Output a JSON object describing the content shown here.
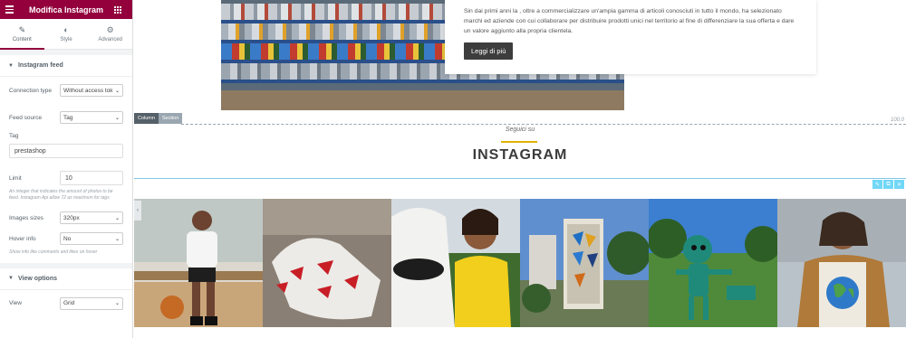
{
  "panel": {
    "title": "Modifica Instagram",
    "tabs": [
      {
        "label": "Content",
        "icon": "pencil-icon"
      },
      {
        "label": "Style",
        "icon": "half-circle-icon"
      },
      {
        "label": "Advanced",
        "icon": "gear-icon"
      }
    ],
    "section_feed": "Instagram feed",
    "connection_type": {
      "label": "Connection type",
      "value": "Without access tok"
    },
    "feed_source": {
      "label": "Feed source",
      "value": "Tag"
    },
    "tag": {
      "label": "Tag",
      "value": "prestashop"
    },
    "limit": {
      "label": "Limit",
      "value": "10",
      "help": "An integer that indicates the amount of photos to be feed. Instagram Api allow 72 as maximum for tags"
    },
    "images_sizes": {
      "label": "Images sizes",
      "value": "320px"
    },
    "hover_info": {
      "label": "Hover info",
      "value": "No",
      "help": "Show info like comments and likes on hover"
    },
    "section_view": "View options",
    "view": {
      "label": "View",
      "value": "Grid"
    }
  },
  "about": {
    "text": "Sin dai primi anni la                   , oltre a commercializzare un'ampia gamma di articoli conosciuti in tutto il mondo, ha selezionato marchi ed aziende con cui collaborare per distribuire prodotti unici nel territorio al fine di differenziare la sua offerta e dare un valore aggiunto alla propria clientela.",
    "button": "Leggi di più"
  },
  "editor": {
    "column_tag": "Column",
    "section_tag": "Section",
    "width_label": "100.0"
  },
  "instagram": {
    "kicker": "Seguici su",
    "title": "INSTAGRAM"
  },
  "colors": {
    "brand": "#93003c",
    "accent_gold": "#e0b100",
    "selection": "#71d7f7"
  },
  "icons": {
    "menu": "hamburger-icon",
    "apps": "grid-icon",
    "edit": "pencil-icon",
    "duplicate": "copy-icon",
    "remove": "close-icon"
  }
}
